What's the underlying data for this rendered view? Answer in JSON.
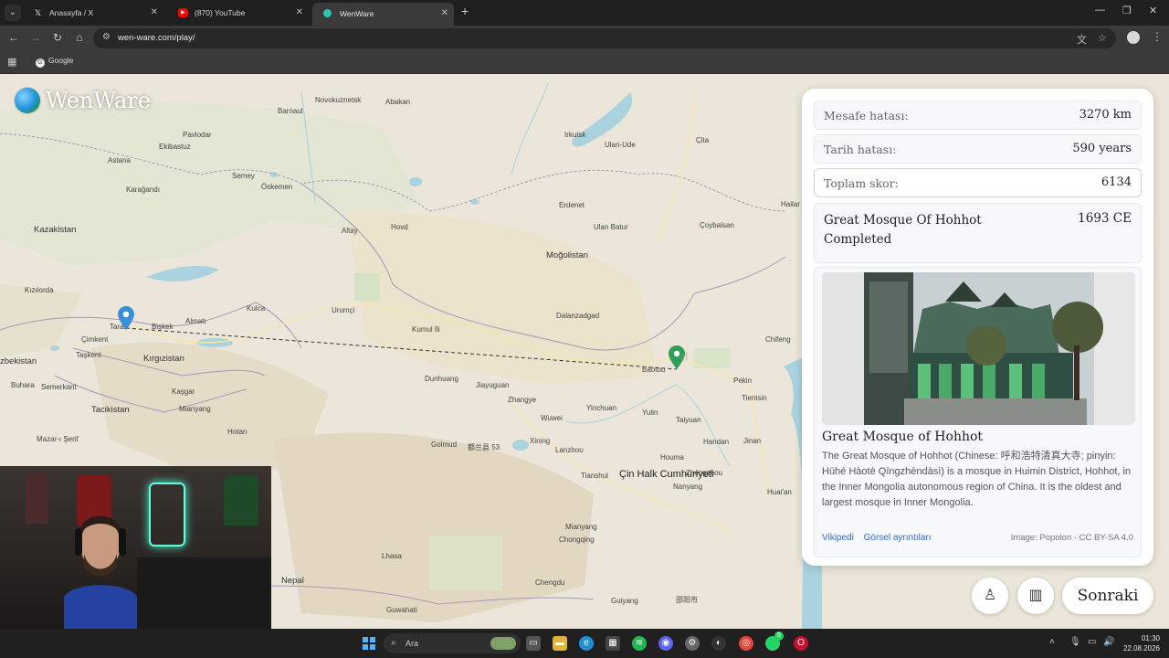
{
  "browser": {
    "tabs": [
      {
        "label": "Anasayfa / X",
        "icon": "x-logo-icon"
      },
      {
        "label": "(870) YouTube",
        "icon": "youtube-icon"
      },
      {
        "label": "WenWare",
        "icon": "wenware-icon"
      }
    ],
    "url": "wen-ware.com/play/",
    "bookmarks": [
      {
        "label": "Google",
        "icon": "google-icon"
      }
    ]
  },
  "app": {
    "logo_text": "WenWare"
  },
  "map": {
    "countries": [
      "Kazakistan",
      "Moğolistan",
      "Kırgızistan",
      "zbekistan",
      "Tacikistan",
      "Çin Halk Cumhuriyeti",
      "Nepal"
    ],
    "cities": [
      "Novokuznetsk",
      "Barnaul",
      "Abakan",
      "Irkutsk",
      "Ulan-Ude",
      "Çita",
      "Pavlodar",
      "Ekibastuz",
      "Astana",
      "Semey",
      "Öskemen",
      "Karağandı",
      "Erdenet",
      "Ulan Batur",
      "Çoybalsan",
      "Hovd",
      "Altay",
      "Kızılorda",
      "Taraz",
      "Bişkek",
      "Almatı",
      "Kulca",
      "Urumçi",
      "Dalanzadgad",
      "Çimkent",
      "Taşkent",
      "Kumul İli",
      "Chifeng",
      "Baotou",
      "Dunhuang",
      "Jiayuguan",
      "Zhangye",
      "Pekin",
      "Tientsin",
      "Buhara",
      "Semerkant",
      "Kaşgar",
      "Yinchuan",
      "Yulin",
      "Taiyuan",
      "Xining",
      "Lanzhou",
      "Wuwei",
      "Handan",
      "Jinan",
      "Hotan",
      "Golmud",
      "Houma",
      "Zhengzhou",
      "Tianshui",
      "Yarkent İlçesi",
      "Nanyang",
      "Mianyang",
      "Chongqing",
      "Lhasa",
      "Chengdu",
      "Guiyang",
      "Guwahati",
      "Mazar-ı Şerif",
      "Hailar",
      "Huai'an"
    ],
    "dist_chars": "都兰县 53",
    "china_chars": "邵阳市",
    "streamer_tag": "wennsss3dq"
  },
  "result": {
    "rows": [
      {
        "key": "Mesafe hatası:",
        "value": "3270 km"
      },
      {
        "key": "Tarih hatası:",
        "value": "590 years"
      },
      {
        "key": "Toplam skor:",
        "value": "6134"
      }
    ],
    "event_title": "Great Mosque Of Hohhot Completed",
    "event_year": "1693 CE",
    "card_title": "Great Mosque of Hohhot",
    "card_desc": "The Great Mosque of Hohhot (Chinese: 呼和浩特清真大寺; pinyin: Hūhé Hàotè Qīngzhēndàsì) is a mosque in Huimin District, Hohhot, in the Inner Mongolia autonomous region of China. It is the oldest and largest mosque in Inner Mongolia.",
    "link_wiki": "Vikipedi",
    "link_image": "Görsel ayrıntıları",
    "credit": "Image: Popolon · CC BY-SA 4.0"
  },
  "controls": {
    "next_label": "Sonraki",
    "streetview_icon": "pegman-icon",
    "map_icon": "map-icon"
  },
  "taskbar": {
    "search_label": "Ara",
    "time": "01:30",
    "date": "22.08.2026",
    "whatsapp_badge": "5"
  },
  "colors": {
    "land": "#ebe6d9",
    "water": "#aad3df",
    "guess_pin": "#3b8fd8",
    "answer_pin": "#2e9e58",
    "accent_link": "#2f6fd8"
  }
}
